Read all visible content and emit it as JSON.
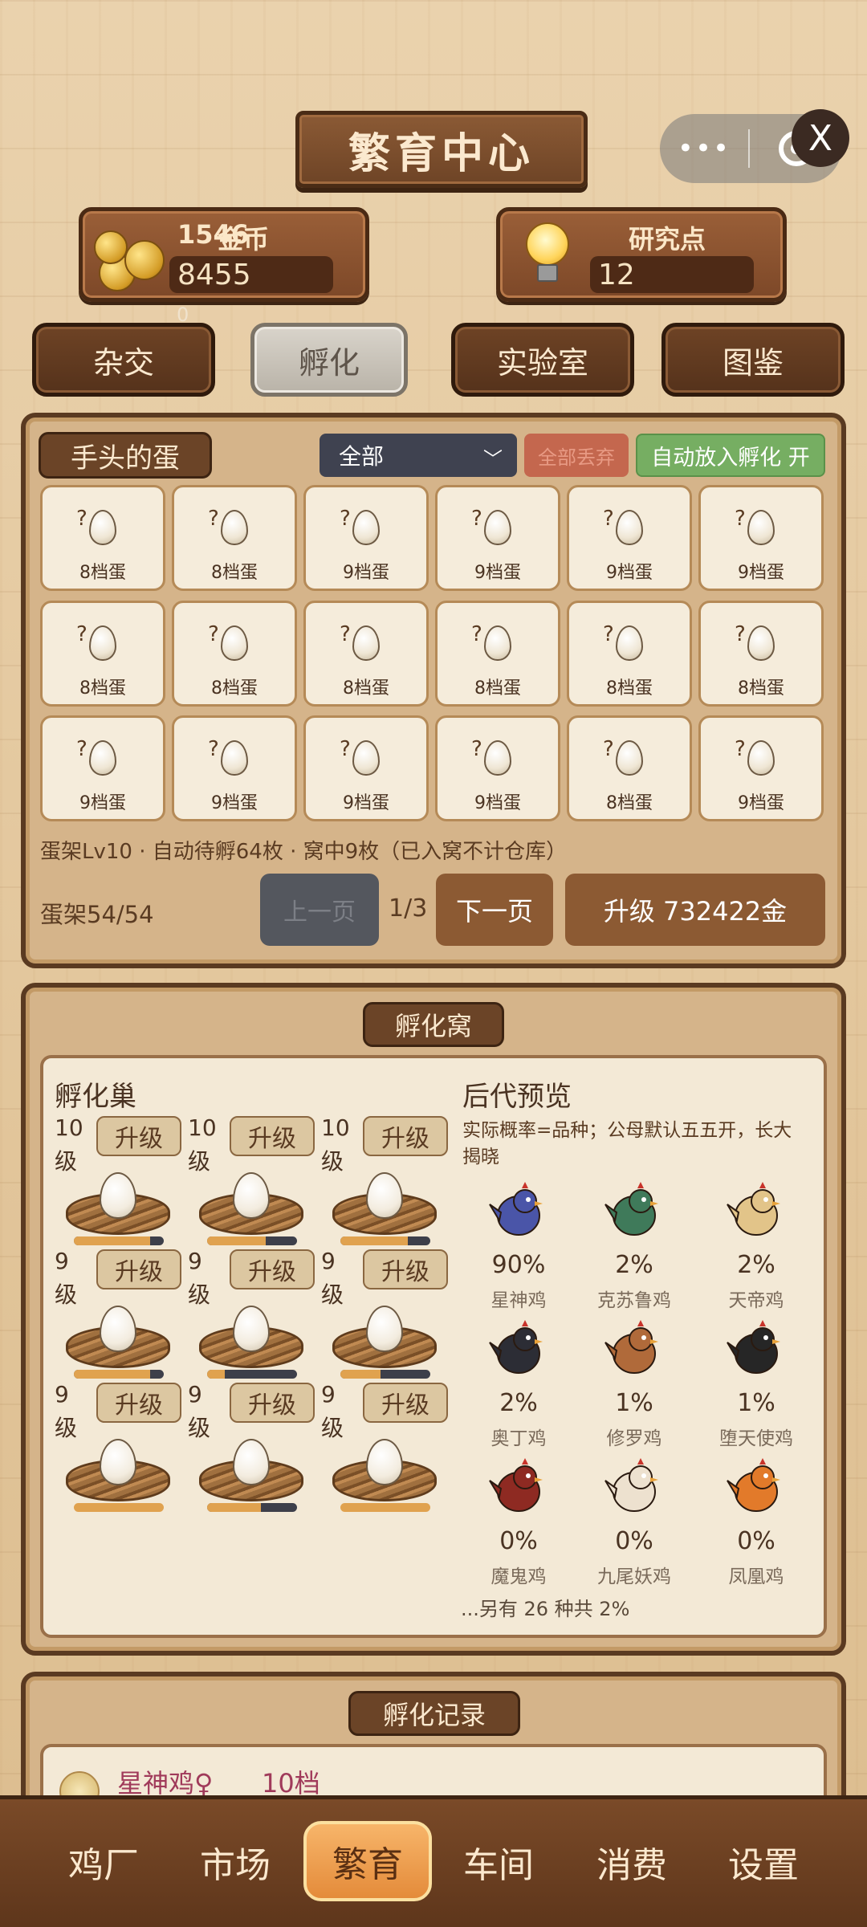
{
  "header": {
    "title": "繁育中心",
    "capsule_dots": "•••",
    "close": "X"
  },
  "resources": {
    "coins_label": "金币",
    "coins_overlap": "1546",
    "coins_value": "8455",
    "coins_small": "0",
    "research_label": "研究点",
    "research_value": "12"
  },
  "tabs": [
    "杂交",
    "孵化",
    "实验室",
    "图鉴"
  ],
  "eggs_panel": {
    "title": "手头的蛋",
    "filter": "全部",
    "discard_all": "全部丢弃",
    "auto_incubate": "自动放入孵化 开",
    "question": "?",
    "eggs": [
      "8档蛋",
      "8档蛋",
      "9档蛋",
      "9档蛋",
      "9档蛋",
      "9档蛋",
      "8档蛋",
      "8档蛋",
      "8档蛋",
      "8档蛋",
      "8档蛋",
      "8档蛋",
      "9档蛋",
      "9档蛋",
      "9档蛋",
      "9档蛋",
      "8档蛋",
      "9档蛋"
    ],
    "info": "蛋架Lv10 · 自动待孵64枚 · 窝中9枚（已入窝不计仓库）",
    "rack": "蛋架54/54",
    "prev": "上一页",
    "page": "1/3",
    "next": "下一页",
    "upgrade": "升级 732422金"
  },
  "incubator": {
    "title": "孵化窝",
    "nests_title": "孵化巢",
    "upgrade_label": "升级",
    "level_suffix": "级",
    "nests": [
      {
        "level": "10",
        "progress": 0.85
      },
      {
        "level": "10",
        "progress": 0.65
      },
      {
        "level": "10",
        "progress": 0.75
      },
      {
        "level": "9",
        "progress": 0.85
      },
      {
        "level": "9",
        "progress": 0.2
      },
      {
        "level": "9",
        "progress": 0.45
      },
      {
        "level": "9",
        "progress": 1.0
      },
      {
        "level": "9",
        "progress": 0.6
      },
      {
        "level": "9",
        "progress": 1.0
      }
    ],
    "preview_title": "后代预览",
    "preview_note": "实际概率=品种；公母默认五五开，长大揭晓",
    "offspring": [
      {
        "pct": "90%",
        "name": "星神鸡",
        "color": "#4a55a8"
      },
      {
        "pct": "2%",
        "name": "克苏鲁鸡",
        "color": "#3f7a5a"
      },
      {
        "pct": "2%",
        "name": "天帝鸡",
        "color": "#e2c489"
      },
      {
        "pct": "2%",
        "name": "奥丁鸡",
        "color": "#2c2d35"
      },
      {
        "pct": "1%",
        "name": "修罗鸡",
        "color": "#b06a3a"
      },
      {
        "pct": "1%",
        "name": "堕天使鸡",
        "color": "#262626"
      },
      {
        "pct": "0%",
        "name": "魔鬼鸡",
        "color": "#8e2a22"
      },
      {
        "pct": "0%",
        "name": "九尾妖鸡",
        "color": "#ede1cf"
      },
      {
        "pct": "0%",
        "name": "凤凰鸡",
        "color": "#e27a2a"
      }
    ],
    "more": "...另有 26 种共 2%"
  },
  "records": {
    "title": "孵化记录",
    "first_name": "星神鸡♀",
    "first_grade": "10档"
  },
  "bottom_nav": [
    "鸡厂",
    "市场",
    "繁育",
    "车间",
    "消费",
    "设置"
  ]
}
